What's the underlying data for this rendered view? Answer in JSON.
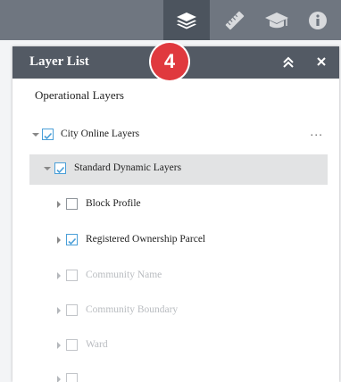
{
  "toolbar": {
    "buttons": [
      {
        "name": "layer-list",
        "icon": "layers-icon",
        "active": true
      },
      {
        "name": "measurement",
        "icon": "ruler-icon",
        "active": false
      },
      {
        "name": "basemap",
        "icon": "mortarboard-icon",
        "active": false
      },
      {
        "name": "about",
        "icon": "info-icon",
        "active": false
      }
    ]
  },
  "panel": {
    "title": "Layer List",
    "badge": "4",
    "collapse_icon": "double-chevron-up-icon",
    "close_icon": "close-icon",
    "section_title": "Operational Layers",
    "more_label": "..."
  },
  "layers": [
    {
      "label": "City Online Layers",
      "checked": true,
      "expanded": true,
      "disabled": false
    },
    {
      "label": "Standard Dynamic Layers",
      "checked": true,
      "expanded": true,
      "disabled": false,
      "selected": true
    },
    {
      "label": "Block Profile",
      "checked": false,
      "expanded": false,
      "disabled": false
    },
    {
      "label": "Registered Ownership Parcel",
      "checked": true,
      "expanded": false,
      "disabled": false
    },
    {
      "label": "Community Name",
      "checked": false,
      "expanded": false,
      "disabled": true
    },
    {
      "label": "Community Boundary",
      "checked": false,
      "expanded": false,
      "disabled": true
    },
    {
      "label": "Ward",
      "checked": false,
      "expanded": false,
      "disabled": true
    }
  ],
  "colors": {
    "toolbar_bg": "#6f7680",
    "toolbar_active": "#4c545e",
    "header_bg": "#535a64",
    "badge": "#e0393e",
    "checkbox_check": "#4a9fd8"
  }
}
